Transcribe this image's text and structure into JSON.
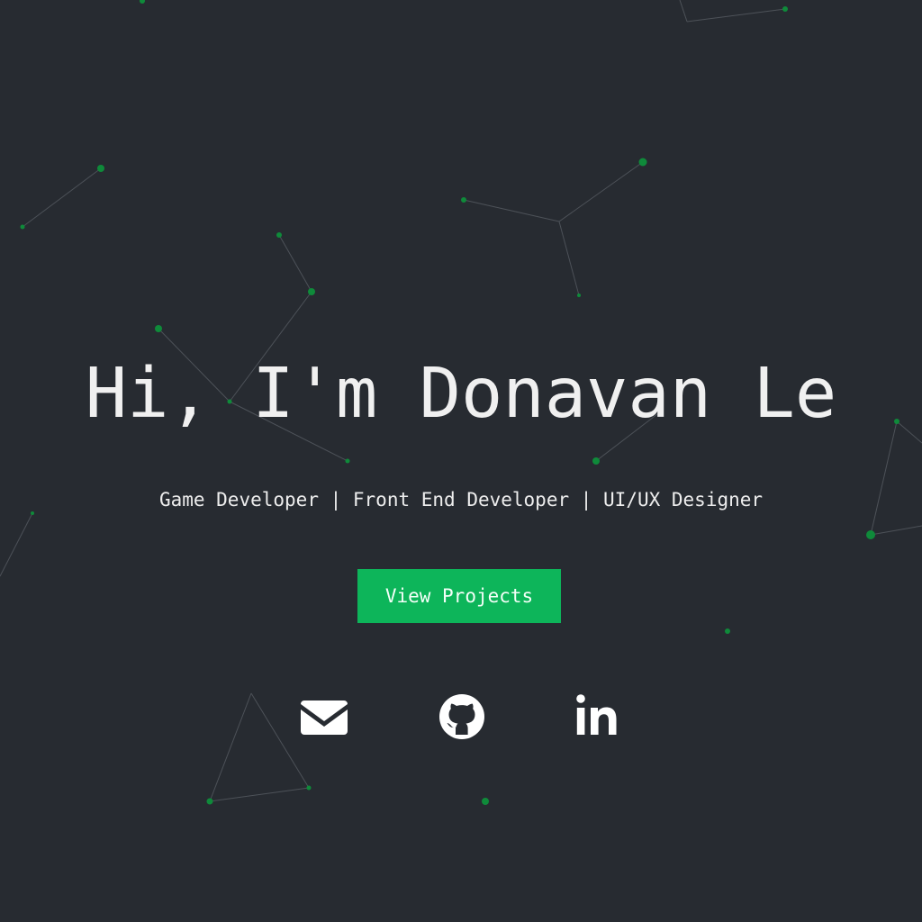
{
  "hero": {
    "title": "Hi, I'm Donavan Le",
    "subtitle": "Game Developer | Front End Developer | UI/UX Designer",
    "cta_label": "View Projects"
  },
  "social": [
    {
      "icon": "envelope-icon",
      "label": "Email"
    },
    {
      "icon": "github-icon",
      "label": "GitHub"
    },
    {
      "icon": "linkedin-icon",
      "label": "LinkedIn"
    }
  ],
  "colors": {
    "background": "#272b31",
    "accent": "#0db55a",
    "text": "#f0f0f0",
    "node": "#0f8a3a",
    "edge": "#5a5f66"
  }
}
